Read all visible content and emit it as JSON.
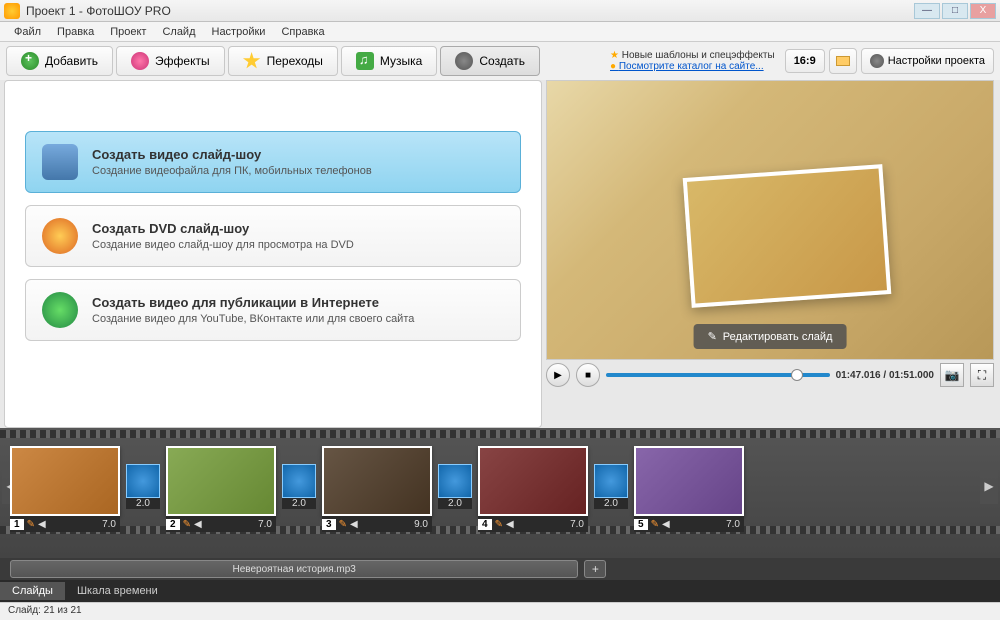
{
  "window": {
    "title": "Проект 1 - ФотоШОУ PRO"
  },
  "menu": [
    "Файл",
    "Правка",
    "Проект",
    "Слайд",
    "Настройки",
    "Справка"
  ],
  "tabs": {
    "add": "Добавить",
    "effects": "Эффекты",
    "transitions": "Переходы",
    "music": "Музыка",
    "create": "Создать"
  },
  "promo": {
    "line1": "Новые шаблоны и спецэффекты",
    "line2": "Посмотрите каталог на сайте..."
  },
  "aspect": "16:9",
  "project_settings": "Настройки проекта",
  "create_options": [
    {
      "title": "Создать видео слайд-шоу",
      "desc": "Создание видеофайла для ПК, мобильных телефонов"
    },
    {
      "title": "Создать DVD слайд-шоу",
      "desc": "Создание видео слайд-шоу для просмотра на DVD"
    },
    {
      "title": "Создать видео для публикации в Интернете",
      "desc": "Создание видео для YouTube, ВКонтакте или для своего сайта"
    }
  ],
  "preview": {
    "edit_label": "Редактировать слайд",
    "time": "01:47.016 / 01:51.000"
  },
  "timeline": {
    "slides": [
      {
        "n": "1",
        "dur": "7.0"
      },
      {
        "n": "2",
        "dur": "7.0"
      },
      {
        "n": "3",
        "dur": "9.0"
      },
      {
        "n": "4",
        "dur": "7.0"
      },
      {
        "n": "5",
        "dur": "7.0"
      }
    ],
    "trans_dur": "2.0",
    "audio": "Невероятная история.mp3"
  },
  "bottom_tabs": {
    "slides": "Слайды",
    "scale": "Шкала времени"
  },
  "status": "Слайд: 21 из 21"
}
